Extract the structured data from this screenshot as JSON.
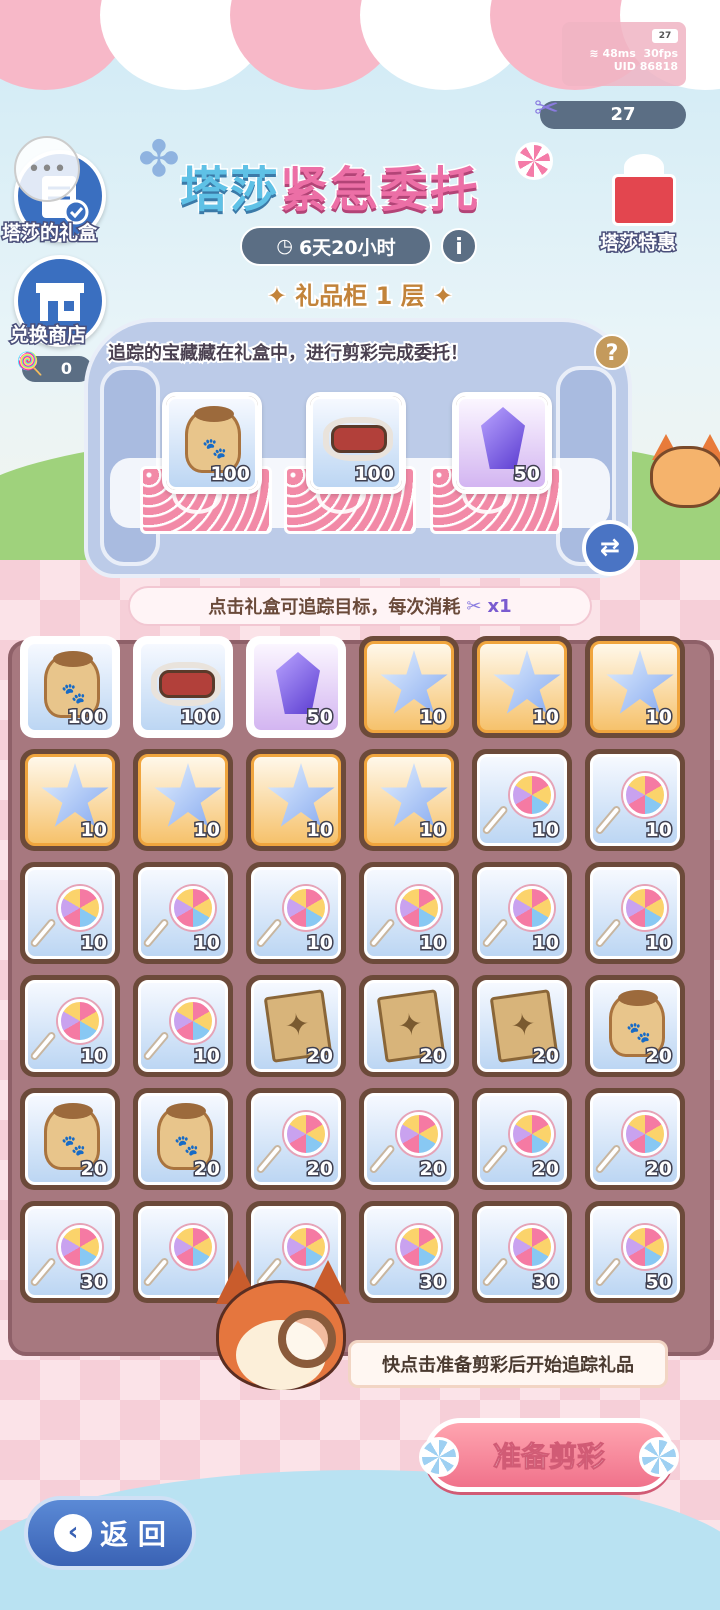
{
  "status": {
    "battery": "27",
    "ping": "48ms",
    "fps": "30fps",
    "uid": "UID 86818"
  },
  "scissors": {
    "count": "27"
  },
  "sidebar": {
    "gift_box_label": "塔莎的礼盒",
    "shop_label": "兑换商店",
    "candy_count": "0"
  },
  "header": {
    "title_part1": "塔莎",
    "title_part2": "紧急委托",
    "timer": "6天20小时",
    "floor": "礼品柜 1 层",
    "special_label": "塔莎特惠"
  },
  "hint": "追踪的宝藏藏在礼盒中，进行剪彩完成委托！",
  "featured": [
    {
      "item": "bag",
      "count": "100",
      "rarity": "blue"
    },
    {
      "item": "sled",
      "count": "100",
      "rarity": "blue"
    },
    {
      "item": "gem",
      "count": "50",
      "rarity": "purple"
    }
  ],
  "cost": {
    "text": "点击礼盒可追踪目标，每次消耗",
    "amount": "x1"
  },
  "grid": [
    [
      {
        "item": "bag",
        "count": "100",
        "rarity": "blue",
        "hl": true
      },
      {
        "item": "sled",
        "count": "100",
        "rarity": "blue",
        "hl": true
      },
      {
        "item": "gem",
        "count": "50",
        "rarity": "purple",
        "hl": true
      },
      {
        "item": "star",
        "count": "10",
        "rarity": "gold"
      },
      {
        "item": "star",
        "count": "10",
        "rarity": "gold"
      },
      {
        "item": "star",
        "count": "10",
        "rarity": "gold"
      }
    ],
    [
      {
        "item": "star",
        "count": "10",
        "rarity": "gold"
      },
      {
        "item": "star",
        "count": "10",
        "rarity": "gold"
      },
      {
        "item": "star",
        "count": "10",
        "rarity": "gold"
      },
      {
        "item": "star",
        "count": "10",
        "rarity": "gold"
      },
      {
        "item": "candy",
        "count": "10",
        "rarity": "blue"
      },
      {
        "item": "candy",
        "count": "10",
        "rarity": "blue"
      }
    ],
    [
      {
        "item": "candy",
        "count": "10",
        "rarity": "blue"
      },
      {
        "item": "candy",
        "count": "10",
        "rarity": "blue"
      },
      {
        "item": "candy",
        "count": "10",
        "rarity": "blue"
      },
      {
        "item": "candy",
        "count": "10",
        "rarity": "blue"
      },
      {
        "item": "candy",
        "count": "10",
        "rarity": "blue"
      },
      {
        "item": "candy",
        "count": "10",
        "rarity": "blue"
      }
    ],
    [
      {
        "item": "candy",
        "count": "10",
        "rarity": "blue"
      },
      {
        "item": "candy",
        "count": "10",
        "rarity": "blue"
      },
      {
        "item": "card",
        "count": "20",
        "rarity": "blue"
      },
      {
        "item": "card",
        "count": "20",
        "rarity": "blue"
      },
      {
        "item": "card",
        "count": "20",
        "rarity": "blue"
      },
      {
        "item": "bag",
        "count": "20",
        "rarity": "blue"
      }
    ],
    [
      {
        "item": "bag",
        "count": "20",
        "rarity": "blue"
      },
      {
        "item": "bag",
        "count": "20",
        "rarity": "blue"
      },
      {
        "item": "candy",
        "count": "20",
        "rarity": "blue"
      },
      {
        "item": "candy",
        "count": "20",
        "rarity": "blue"
      },
      {
        "item": "candy",
        "count": "20",
        "rarity": "blue"
      },
      {
        "item": "candy",
        "count": "20",
        "rarity": "blue"
      }
    ],
    [
      {
        "item": "candy",
        "count": "30",
        "rarity": "blue"
      },
      {
        "item": "candy",
        "count": "",
        "rarity": "blue"
      },
      {
        "item": "candy",
        "count": "",
        "rarity": "blue"
      },
      {
        "item": "candy",
        "count": "30",
        "rarity": "blue"
      },
      {
        "item": "candy",
        "count": "30",
        "rarity": "blue"
      },
      {
        "item": "candy",
        "count": "50",
        "rarity": "blue"
      }
    ]
  ],
  "speech": "快点击准备剪彩后开始追踪礼品",
  "buttons": {
    "prepare": "准备剪彩",
    "back": "返 回"
  },
  "colors": {
    "accent_pink": "#f0728b",
    "accent_blue": "#3a62b4",
    "board": "#a7787f"
  }
}
